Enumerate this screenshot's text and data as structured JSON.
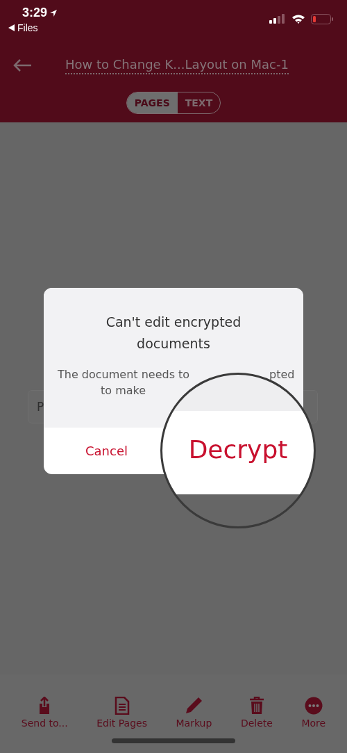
{
  "status_bar": {
    "time": "3:29",
    "back_app": "Files"
  },
  "nav": {
    "title": "How to Change K...Layout on Mac-1"
  },
  "tabs": [
    {
      "label": "PAGES",
      "selected": true
    },
    {
      "label": "TEXT",
      "selected": false
    }
  ],
  "background_field": {
    "text": "P"
  },
  "dialog": {
    "title": "Can't edit encrypted documents",
    "message_fragments": [
      "The document needs to",
      "pted",
      "to make"
    ],
    "cancel": "Cancel"
  },
  "magnifier": {
    "label": "Decrypt"
  },
  "toolbar": [
    {
      "kind": "send",
      "label": "Send to..."
    },
    {
      "kind": "pages",
      "label": "Edit Pages"
    },
    {
      "kind": "markup",
      "label": "Markup"
    },
    {
      "kind": "delete",
      "label": "Delete"
    },
    {
      "kind": "more",
      "label": "More"
    }
  ]
}
